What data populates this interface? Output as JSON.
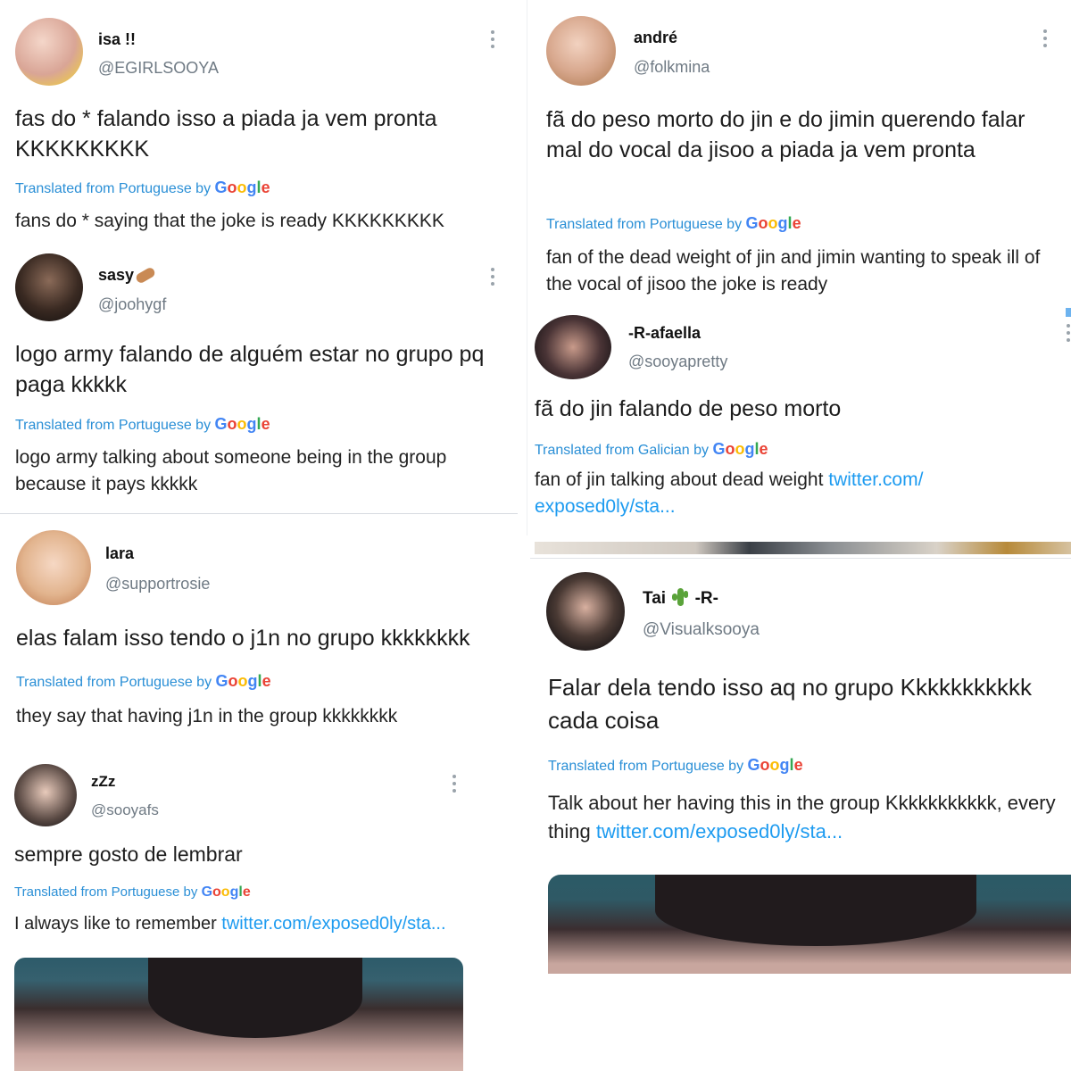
{
  "tweets": [
    {
      "name": "isa !!",
      "handle": "@EGIRLSOOYA",
      "original": "fas do * falando isso a piada ja vem pronta KKKKKKKKK",
      "translated_from": "Translated from Portuguese by",
      "translation": "fans do * saying that the joke is ready KKKKKKKKK",
      "link": ""
    },
    {
      "name": "sasy",
      "handle": "@joohygf",
      "original": "logo army falando de alguém estar no grupo pq paga kkkkk",
      "translated_from": "Translated from Portuguese by",
      "translation": "logo army talking about someone being in the group because it pays kkkkk",
      "link": ""
    },
    {
      "name": "lara",
      "handle": "@supportrosie",
      "original": "elas falam isso tendo o j1n no grupo kkkkkkkk",
      "translated_from": "Translated from Portuguese by",
      "translation": "they say that having j1n in the group kkkkkkkk",
      "link": ""
    },
    {
      "name": "zZz",
      "handle": "@sooyafs",
      "original": "sempre gosto de lembrar",
      "translated_from": "Translated from Portuguese by",
      "translation": "I always like to remember ",
      "link": "twitter.com/exposed0ly/sta..."
    },
    {
      "name": "andré",
      "handle": "@folkmina",
      "original": "fã do peso morto do jin e do jimin querendo falar mal do vocal da jisoo a piada ja vem pronta",
      "translated_from": "Translated from Portuguese by",
      "translation": "fan of the dead weight of jin and jimin wanting to speak ill of the vocal of jisoo the joke is ready",
      "link": ""
    },
    {
      "name": "-R-afaella",
      "handle": "@sooyapretty",
      "original": "fã do jin falando de peso morto",
      "translated_from": "Translated from Galician by",
      "translation": "fan of jin talking about dead weight ",
      "link": "twitter.com/ exposed0ly/sta..."
    },
    {
      "name": "Tai",
      "name_suffix": "-R-",
      "handle": "@Visualksooya",
      "original": "Falar dela tendo isso aq no grupo Kkkkkkkkkkk cada coisa",
      "translated_from": "Translated from Portuguese by",
      "translation": "Talk about her having this in the group Kkkkkkkkkkk, every thing ",
      "link": "twitter.com/exposed0ly/sta..."
    }
  ],
  "google_letters": [
    "G",
    "o",
    "o",
    "g",
    "l",
    "e"
  ],
  "icons": {
    "more": "more-vertical-icon",
    "emoji_sasy": "peanut-emoji-icon",
    "emoji_tai": "cactus-emoji-icon"
  },
  "colors": {
    "link": "#1d9bf0",
    "translated": "#2a8fd6",
    "handle": "#6f7a84"
  }
}
